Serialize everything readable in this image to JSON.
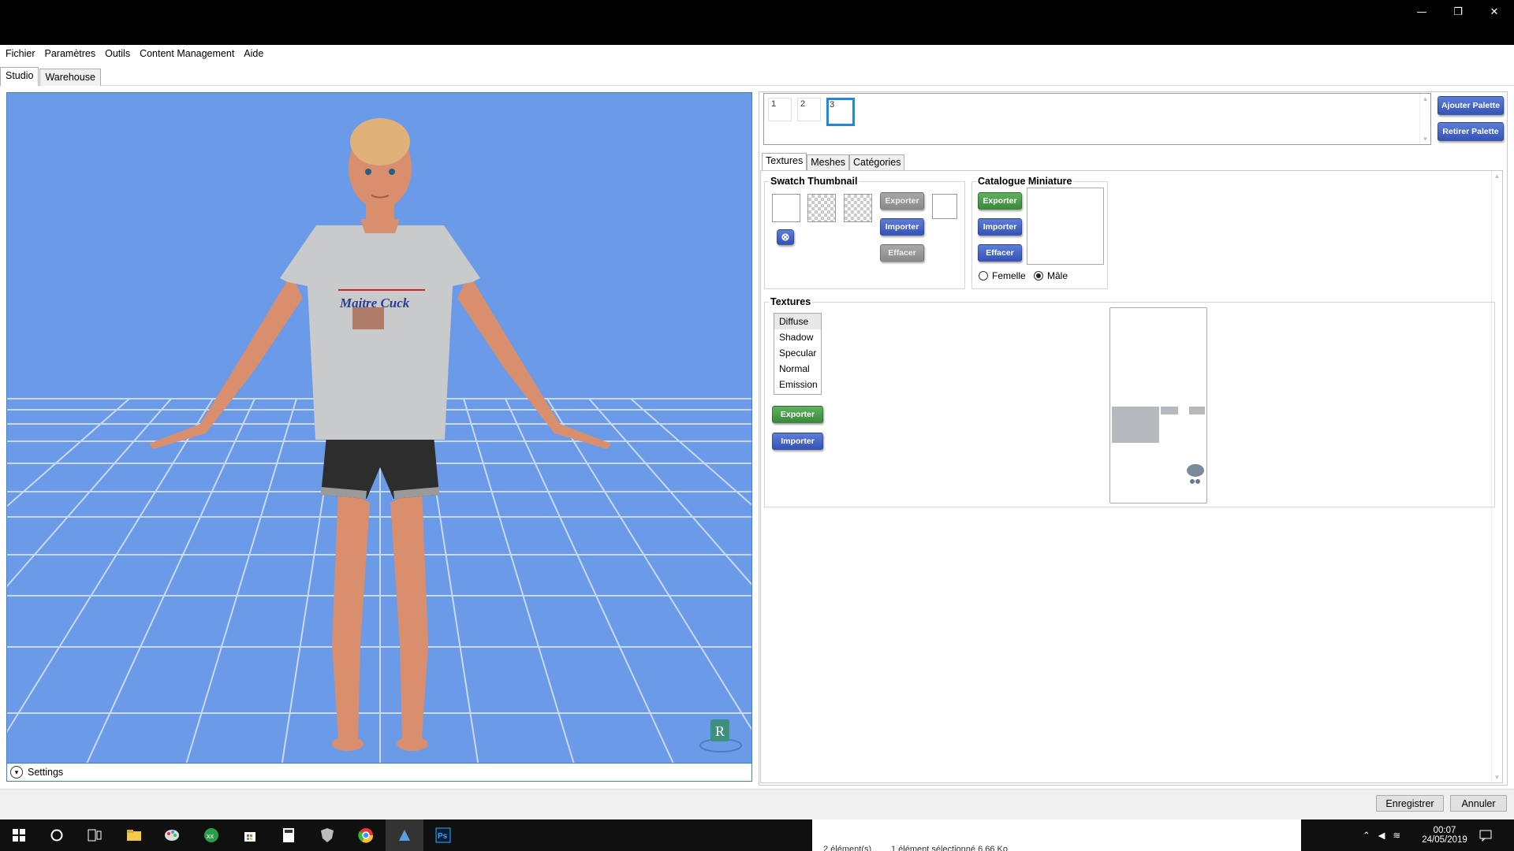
{
  "window": {
    "minimize": "—",
    "restore": "❐",
    "close": "✕"
  },
  "menu": [
    "Fichier",
    "Paramètres",
    "Outils",
    "Content Management",
    "Aide"
  ],
  "top_tabs": [
    {
      "label": "Studio",
      "active": true
    },
    {
      "label": "Warehouse",
      "active": false
    }
  ],
  "viewport": {
    "shirt_text": "Maitre Cuck",
    "corner_logo": "R",
    "settings_label": "Settings"
  },
  "palette": {
    "swatches": [
      "1",
      "2",
      "3"
    ],
    "selected": "3",
    "add_label": "Ajouter Palette",
    "remove_label": "Retirer Palette"
  },
  "inner_tabs": [
    {
      "label": "Textures",
      "active": true
    },
    {
      "label": "Meshes",
      "active": false
    },
    {
      "label": "Catégories",
      "active": false
    }
  ],
  "swatch_thumbnail": {
    "title": "Swatch Thumbnail",
    "export_label": "Exporter",
    "import_label": "Importer",
    "clear_label": "Effacer"
  },
  "catalogue_miniature": {
    "title": "Catalogue Miniature",
    "export_label": "Exporter",
    "import_label": "Importer",
    "clear_label": "Effacer",
    "gender_female": "Femelle",
    "gender_male": "Mâle",
    "selected_gender": "Mâle"
  },
  "textures": {
    "title": "Textures",
    "list": [
      "Diffuse",
      "Shadow",
      "Specular",
      "Normal",
      "Emission"
    ],
    "selected": "Diffuse",
    "export_label": "Exporter",
    "import_label": "Importer"
  },
  "footer": {
    "save_label": "Enregistrer",
    "cancel_label": "Annuler"
  },
  "taskbar": {
    "status_left": "2 élément(s)",
    "status_right": "1 élément sélectionné  6,66 Ko",
    "time": "00:07",
    "date": "24/05/2019",
    "apps": [
      "start-icon",
      "cortana-icon",
      "task-view-icon",
      "file-explorer-icon",
      "paint-icon",
      "app-icon",
      "store-icon",
      "calculator-icon",
      "shield-icon",
      "chrome-icon",
      "sims-studio-icon",
      "photoshop-icon"
    ]
  },
  "colors": {
    "viewport_bg": "#6b9be8",
    "button_blue": "#3f5fc4",
    "button_green": "#46994a",
    "button_grey": "#9a9a9a",
    "selection_blue": "#1e88e5"
  }
}
